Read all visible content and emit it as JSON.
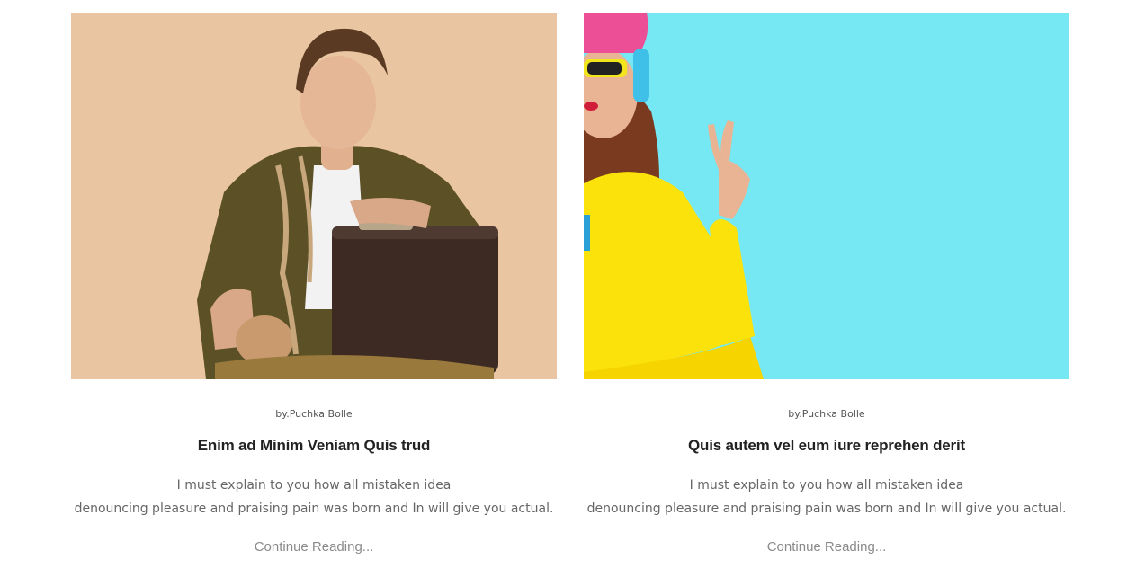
{
  "posts": [
    {
      "image_alt": "man with suitcase and rope",
      "author": "by.Puchka Bolle",
      "title": "Enim ad Minim Veniam Quis trud",
      "excerpt_line1": "I must explain to you how all mistaken idea",
      "excerpt_line2": "denouncing pleasure and praising pain was born and In will give you actual.",
      "read_more": "Continue Reading..."
    },
    {
      "image_alt": "woman in yellow sweater making peace sign",
      "author": "by.Puchka Bolle",
      "title": "Quis autem vel eum iure reprehen derit",
      "excerpt_line1": "I must explain to you how all mistaken idea",
      "excerpt_line2": "denouncing pleasure and praising pain was born and In will give you actual.",
      "read_more": "Continue Reading..."
    }
  ]
}
